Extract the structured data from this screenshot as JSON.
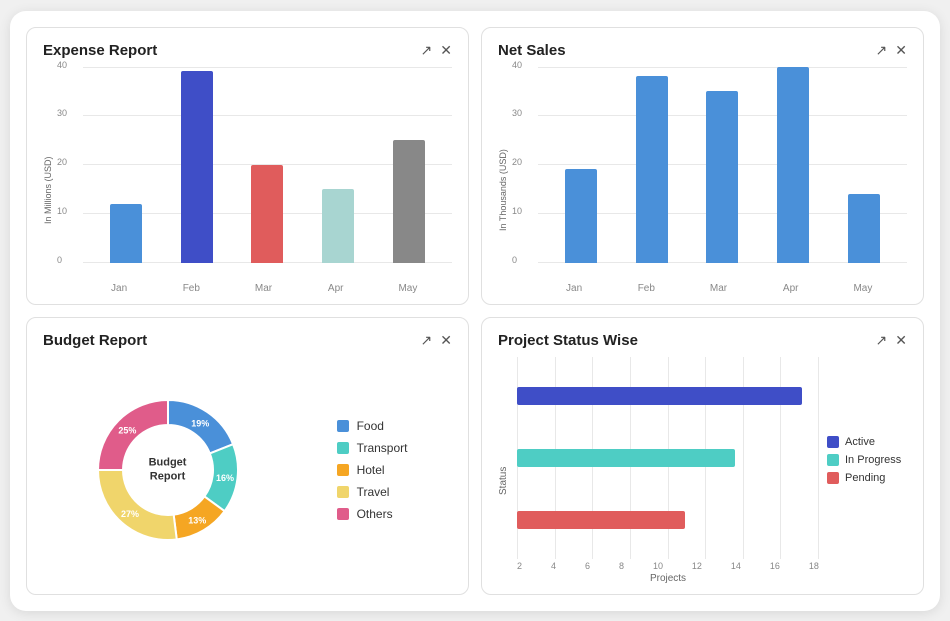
{
  "expense_report": {
    "title": "Expense Report",
    "y_label": "In Millions (USD)",
    "y_ticks": [
      "40",
      "30",
      "20",
      "10",
      "0"
    ],
    "bars": [
      {
        "label": "Jan",
        "value": 12,
        "color": "#4a90d9"
      },
      {
        "label": "Feb",
        "value": 39,
        "color": "#3f4ec7"
      },
      {
        "label": "Mar",
        "value": 20,
        "color": "#e05c5c"
      },
      {
        "label": "Apr",
        "value": 15,
        "color": "#a8d5d1"
      },
      {
        "label": "May",
        "value": 25,
        "color": "#888888"
      }
    ],
    "max": 40,
    "expand_label": "↗",
    "close_label": "✕"
  },
  "net_sales": {
    "title": "Net Sales",
    "y_label": "In Thousands (USD)",
    "y_ticks": [
      "40",
      "30",
      "20",
      "10",
      "0"
    ],
    "bars": [
      {
        "label": "Jan",
        "value": 19,
        "color": "#4a90d9"
      },
      {
        "label": "Feb",
        "value": 38,
        "color": "#4a90d9"
      },
      {
        "label": "Mar",
        "value": 35,
        "color": "#4a90d9"
      },
      {
        "label": "Apr",
        "value": 40,
        "color": "#4a90d9"
      },
      {
        "label": "May",
        "value": 14,
        "color": "#4a90d9"
      }
    ],
    "max": 40,
    "expand_label": "↗",
    "close_label": "✕"
  },
  "budget_report": {
    "title": "Budget Report",
    "center_text": "Budget\nReport",
    "expand_label": "↗",
    "close_label": "✕",
    "segments": [
      {
        "label": "Food",
        "value": 19,
        "color": "#4a90d9"
      },
      {
        "label": "Transport",
        "value": 16,
        "color": "#4ecdc4"
      },
      {
        "label": "Hotel",
        "value": 13,
        "color": "#f5a623"
      },
      {
        "label": "Travel",
        "value": 27,
        "color": "#f0d56b"
      },
      {
        "label": "Others",
        "value": 25,
        "color": "#e05c8a"
      }
    ]
  },
  "project_status": {
    "title": "Project Status Wise",
    "expand_label": "↗",
    "close_label": "✕",
    "y_label": "Status",
    "x_label": "Projects",
    "x_ticks": [
      "2",
      "4",
      "6",
      "8",
      "10",
      "12",
      "14",
      "16",
      "18"
    ],
    "bars": [
      {
        "label": "Active",
        "value": 17,
        "color": "#3f4ec7"
      },
      {
        "label": "In Progress",
        "value": 13,
        "color": "#4ecdc4"
      },
      {
        "label": "Pending",
        "value": 10,
        "color": "#e05c5c"
      }
    ],
    "max": 18,
    "legend": [
      {
        "label": "Active",
        "color": "#3f4ec7"
      },
      {
        "label": "In Progress",
        "color": "#4ecdc4"
      },
      {
        "label": "Pending",
        "color": "#e05c5c"
      }
    ]
  }
}
